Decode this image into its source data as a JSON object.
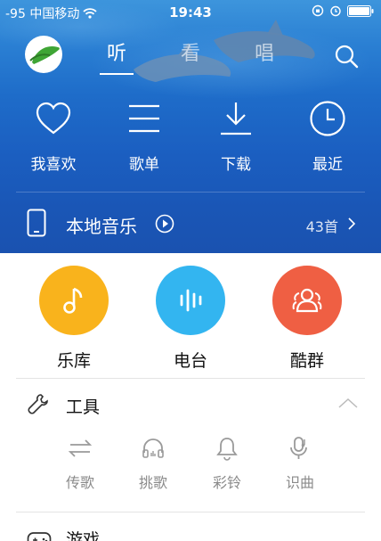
{
  "status_bar": {
    "carrier": "-95 中国移动",
    "time": "19:43"
  },
  "nav": {
    "tabs": [
      {
        "label": "听",
        "active": true
      },
      {
        "label": "看",
        "active": false
      },
      {
        "label": "唱",
        "active": false
      }
    ]
  },
  "quick_links": [
    {
      "label": "我喜欢",
      "icon": "heart-icon"
    },
    {
      "label": "歌单",
      "icon": "list-icon"
    },
    {
      "label": "下载",
      "icon": "download-icon"
    },
    {
      "label": "最近",
      "icon": "clock-icon"
    }
  ],
  "local_music": {
    "title": "本地音乐",
    "count": "43首"
  },
  "categories": [
    {
      "label": "乐库",
      "color": "#f9b31c",
      "icon": "music-note-icon"
    },
    {
      "label": "电台",
      "color": "#33b5f0",
      "icon": "radio-wave-icon"
    },
    {
      "label": "酷群",
      "color": "#ef5f43",
      "icon": "group-icon"
    }
  ],
  "tools": {
    "title": "工具",
    "items": [
      {
        "label": "传歌",
        "icon": "transfer-icon"
      },
      {
        "label": "挑歌",
        "icon": "headphones-icon"
      },
      {
        "label": "彩铃",
        "icon": "bell-icon"
      },
      {
        "label": "识曲",
        "icon": "mic-note-icon"
      }
    ]
  },
  "games": {
    "title": "游戏"
  },
  "colors": {
    "hero_blue": "#1e6cc9",
    "text_primary": "#111111",
    "text_secondary": "#8a8a8a"
  }
}
